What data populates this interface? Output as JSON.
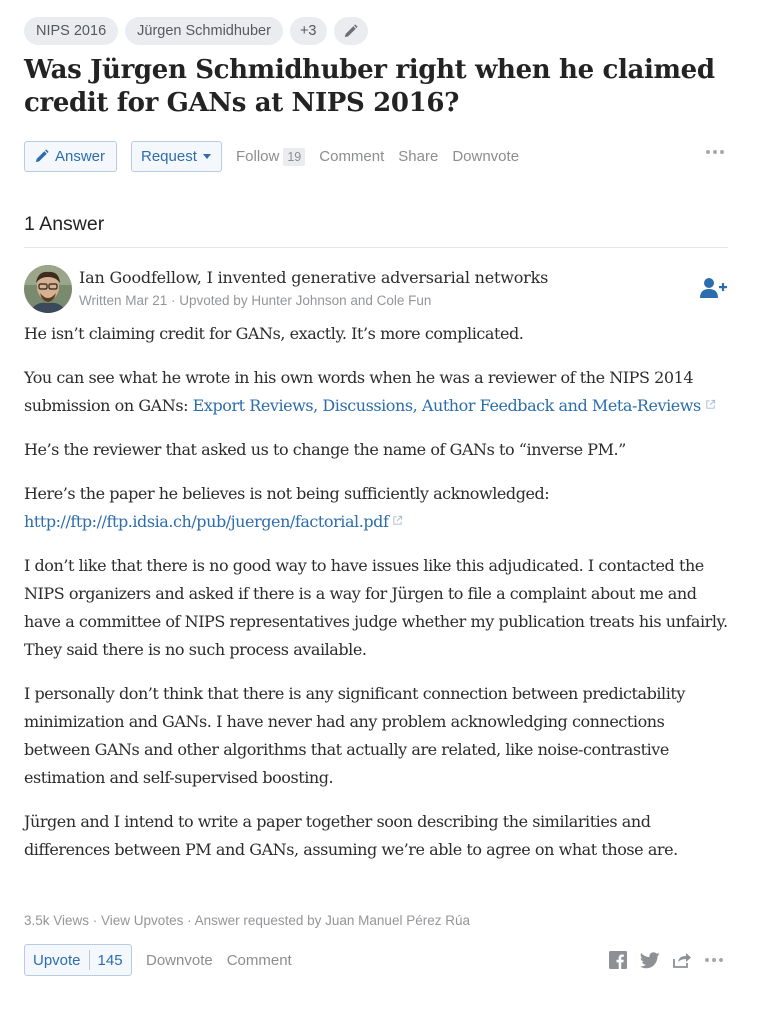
{
  "topics": [
    "NIPS 2016",
    "Jürgen Schmidhuber",
    "+3"
  ],
  "question": {
    "title": "Was Jürgen Schmidhuber right when he claimed credit for GANs at NIPS 2016?"
  },
  "action_bar": {
    "answer_label": "Answer",
    "request_label": "Request",
    "follow_label": "Follow",
    "follow_count": "19",
    "comment_label": "Comment",
    "share_label": "Share",
    "downvote_label": "Downvote"
  },
  "answers_header": "1 Answer",
  "answer": {
    "author_name": "Ian Goodfellow, I invented generative adversarial networks",
    "meta": "Written Mar 21 · Upvoted by Hunter Johnson and Cole Fun",
    "paragraphs": {
      "p1": "He isn’t claiming credit for GANs, exactly. It’s more complicated.",
      "p2_text": "You can see what he wrote in his own words when he was a reviewer of the NIPS 2014 submission on GANs: ",
      "p2_link": "Export Reviews, Discussions, Author Feedback and Meta-Reviews",
      "p3": "He’s the reviewer that asked us to change the name of GANs to “inverse PM.”",
      "p4_text": "Here’s the paper he believes is not being sufficiently acknowledged: ",
      "p4_link": "http://ftp://ftp.idsia.ch/pub/juergen/factorial.pdf",
      "p5": "I don’t like that there is no good way to have issues like this adjudicated. I contacted the NIPS organizers and asked if there is a way for Jürgen to file a complaint about me and have a committee of NIPS representatives judge whether my publication treats his unfairly. They said there is no such process available.",
      "p6": "I personally don’t think that there is any significant connection between predictability minimization and GANs. I have never had any problem acknowledging connections between GANs and other algorithms that actually are related, like noise-contrastive estimation and self-supervised boosting.",
      "p7": "Jürgen and I intend to write a paper together soon describing the similarities and differences between PM and GANs, assuming we’re able to agree on what those are."
    },
    "stats": "3.5k Views · View Upvotes · Answer requested by Juan Manuel Pérez Rúa",
    "upvote_label": "Upvote",
    "upvote_count": "145",
    "downvote_label": "Downvote",
    "comment_label": "Comment"
  },
  "colors": {
    "link": "#2b6dad",
    "chip_bg": "#eaecef",
    "muted": "#8c8d8f",
    "text": "#2c2c2d"
  }
}
